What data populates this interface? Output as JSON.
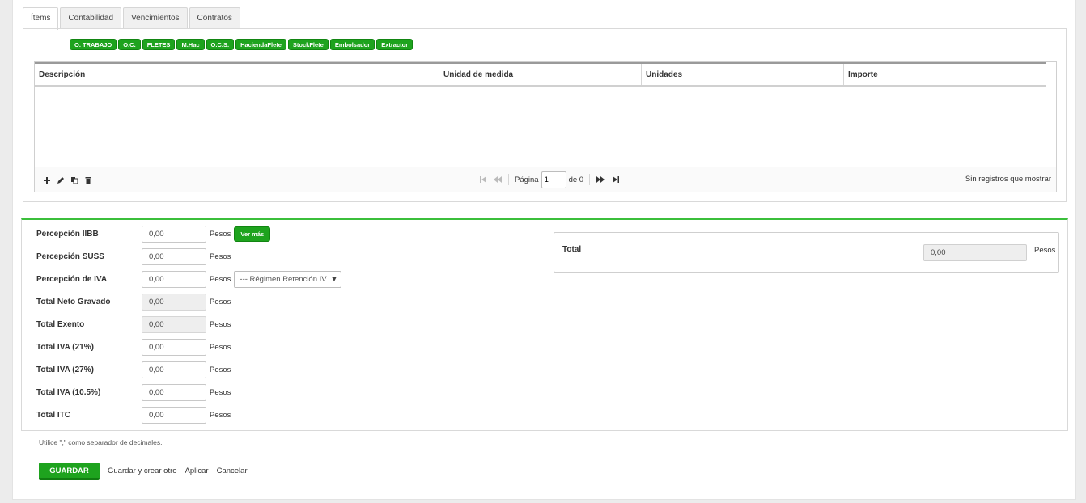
{
  "tabs": [
    {
      "label": "Ítems",
      "active": true
    },
    {
      "label": "Contabilidad"
    },
    {
      "label": "Vencimientos"
    },
    {
      "label": "Contratos"
    }
  ],
  "chips": [
    "O. TRABAJO",
    "O.C.",
    "FLETES",
    "M.Hac",
    "O.C.S.",
    "HaciendaFlete",
    "StockFlete",
    "Embolsador",
    "Extractor"
  ],
  "grid": {
    "columns": [
      "Descripción",
      "Unidad de medida",
      "Unidades",
      "Importe"
    ],
    "pager": {
      "page_label": "Página",
      "page_value": "1",
      "of_label": "de 0"
    },
    "status": "Sin registros que mostrar"
  },
  "totals": {
    "percepcion_iibb": {
      "label": "Percepción IIBB",
      "value": "0,00",
      "unit": "Pesos",
      "action": "Ver más"
    },
    "percepcion_suss": {
      "label": "Percepción SUSS",
      "value": "0,00",
      "unit": "Pesos"
    },
    "percepcion_iva": {
      "label": "Percepción de IVA",
      "value": "0,00",
      "unit": "Pesos",
      "select": "--- Régimen Retención IV"
    },
    "neto_gravado": {
      "label": "Total Neto Gravado",
      "value": "0,00",
      "unit": "Pesos"
    },
    "exento": {
      "label": "Total Exento",
      "value": "0,00",
      "unit": "Pesos"
    },
    "iva21": {
      "label": "Total IVA (21%)",
      "value": "0,00",
      "unit": "Pesos"
    },
    "iva27": {
      "label": "Total IVA (27%)",
      "value": "0,00",
      "unit": "Pesos"
    },
    "iva105": {
      "label": "Total IVA (10.5%)",
      "value": "0,00",
      "unit": "Pesos"
    },
    "itc": {
      "label": "Total ITC",
      "value": "0,00",
      "unit": "Pesos"
    },
    "total": {
      "label": "Total",
      "value": "0,00",
      "unit": "Pesos"
    }
  },
  "hint": "Utilice \",\" como separador de decimales.",
  "actions": {
    "save": "GUARDAR",
    "save_new": "Guardar y crear otro",
    "apply": "Aplicar",
    "cancel": "Cancelar"
  },
  "colors": {
    "accent": "#1ea31e",
    "section_border": "#3bbf3b"
  }
}
